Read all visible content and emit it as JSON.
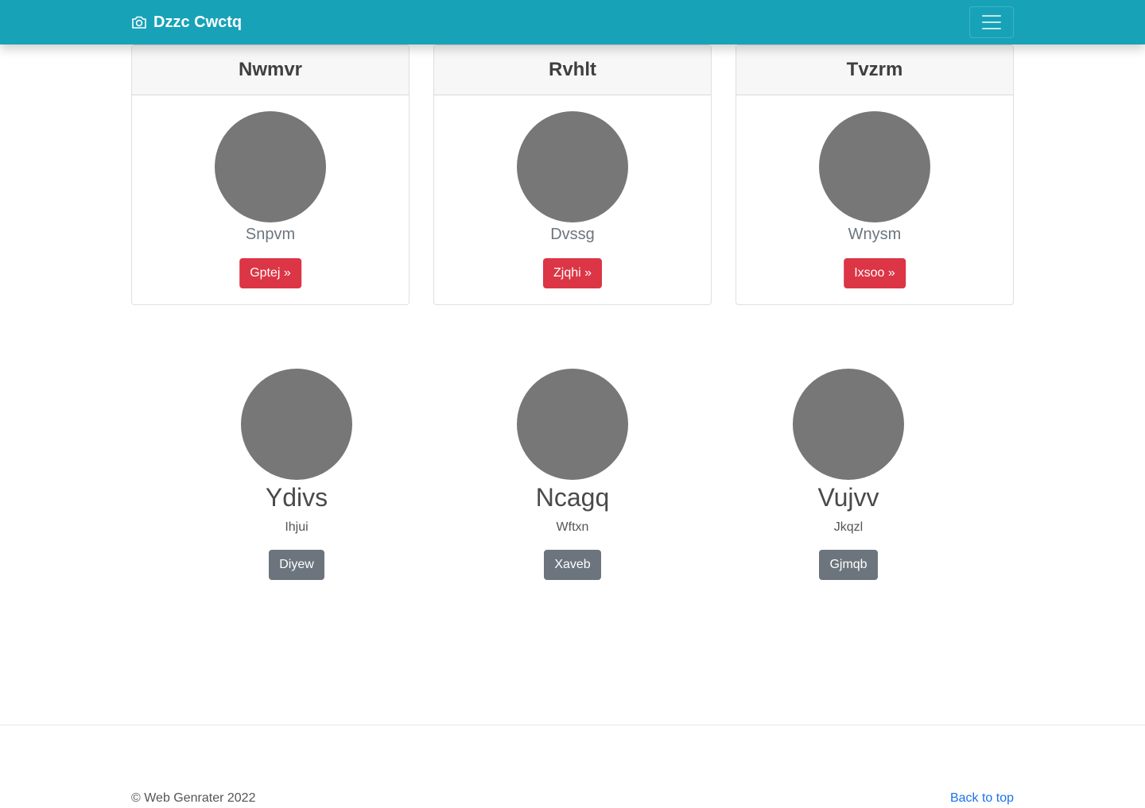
{
  "navbar": {
    "brand": "Dzzc Cwctq",
    "brand_icon": "camera-icon",
    "toggler_icon": "hamburger-menu-icon"
  },
  "cards": [
    {
      "title": "Nwmvr",
      "subtitle": "Snpvm",
      "button": "Gptej »"
    },
    {
      "title": "Rvhlt",
      "subtitle": "Dvssg",
      "button": "Zjqhi »"
    },
    {
      "title": "Tvzrm",
      "subtitle": "Wnysm",
      "button": "Ixsoo »"
    }
  ],
  "profiles": [
    {
      "name": "Ydivs",
      "subtitle": "Ihjui",
      "button": "Diyew"
    },
    {
      "name": "Ncagq",
      "subtitle": "Wftxn",
      "button": "Xaveb"
    },
    {
      "name": "Vujvv",
      "subtitle": "Jkqzl",
      "button": "Gjmqb"
    }
  ],
  "footer": {
    "copyright": "© Web Genrater 2022",
    "back_to_top": "Back to top"
  },
  "colors": {
    "navbar": "#17a2b8",
    "danger": "#dc3545",
    "secondary": "#6c757d",
    "avatar": "#777777",
    "link": "#1a73e8"
  }
}
